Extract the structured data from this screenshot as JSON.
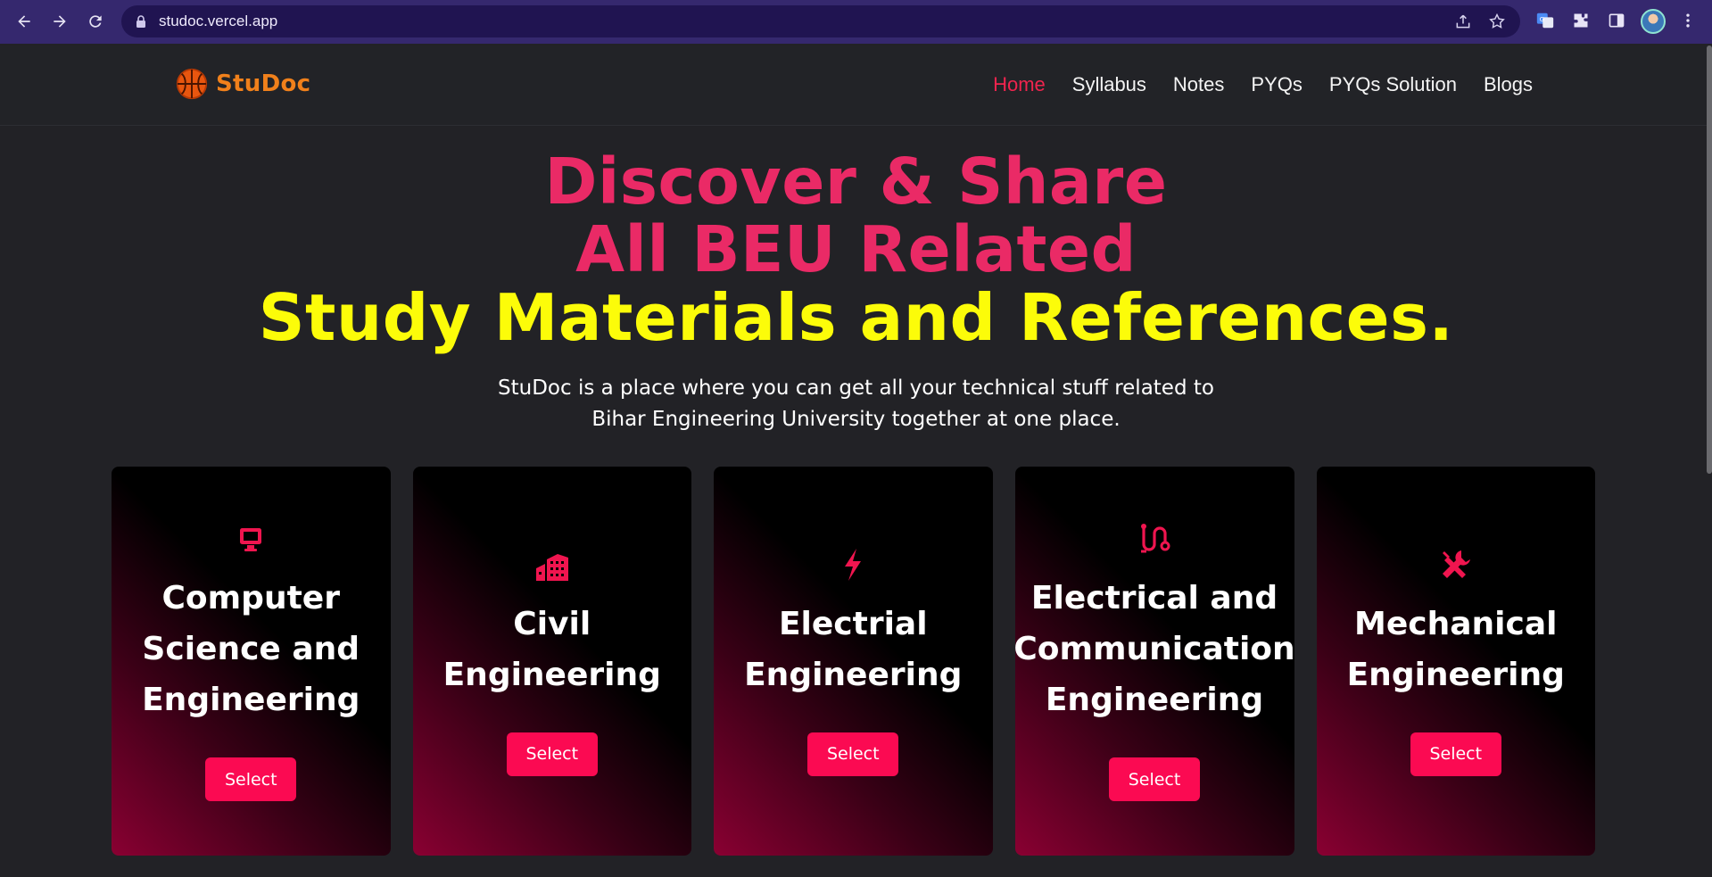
{
  "browser": {
    "url": "studoc.vercel.app"
  },
  "site": {
    "brand": "StuDoc",
    "nav": [
      {
        "label": "Home",
        "active": true
      },
      {
        "label": "Syllabus",
        "active": false
      },
      {
        "label": "Notes",
        "active": false
      },
      {
        "label": "PYQs",
        "active": false
      },
      {
        "label": "PYQs Solution",
        "active": false
      },
      {
        "label": "Blogs",
        "active": false
      }
    ]
  },
  "hero": {
    "line1": "Discover & Share",
    "line2": "All BEU Related",
    "line3": "Study Materials and References.",
    "description": "StuDoc is a place where you can get all your technical stuff related to Bihar Engineering University together at one place."
  },
  "cards": [
    {
      "icon": "computer-icon",
      "title": "Computer Science and Engineering",
      "button": "Select"
    },
    {
      "icon": "building-icon",
      "title": "Civil Engineering",
      "button": "Select"
    },
    {
      "icon": "lightning-icon",
      "title": "Electrial Engineering",
      "button": "Select"
    },
    {
      "icon": "circuit-icon",
      "title": "Electrical and Communication Engineering",
      "button": "Select"
    },
    {
      "icon": "tools-icon",
      "title": "Mechanical Engineering",
      "button": "Select"
    }
  ],
  "colors": {
    "accent": "#fb0a52",
    "hero_pink": "#ea2a66",
    "hero_yellow": "#fcfc09",
    "brand_orange": "#f0801b",
    "background": "#222226"
  }
}
